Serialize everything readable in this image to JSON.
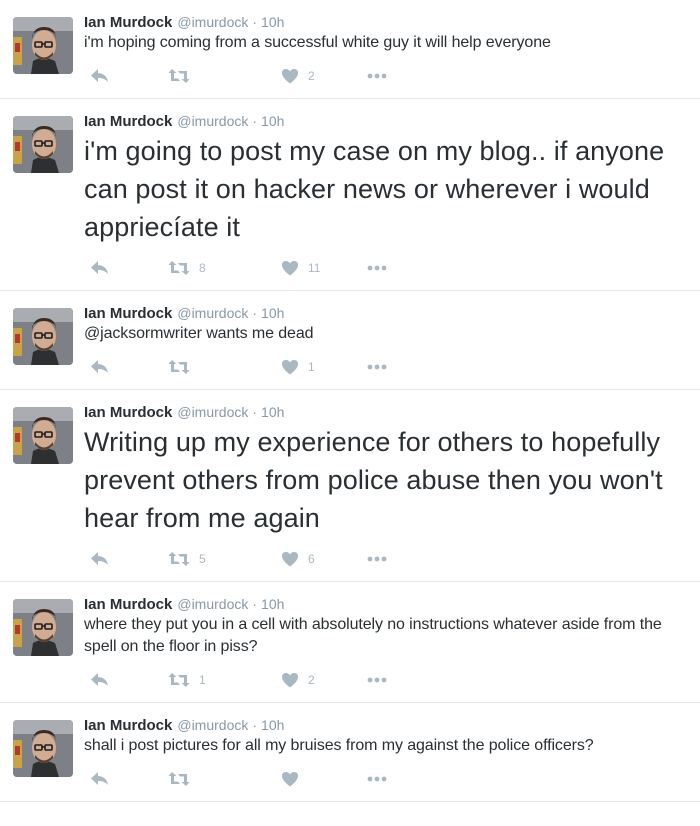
{
  "tweets": [
    {
      "name": "Ian Murdock",
      "handle": "@imurdock",
      "sep": "·",
      "time": "10h",
      "text": "i'm hoping coming from a successful white guy it will help everyone",
      "size": "small",
      "retweets": "",
      "likes": "2"
    },
    {
      "name": "Ian Murdock",
      "handle": "@imurdock",
      "sep": "·",
      "time": "10h",
      "text": "i'm going to post my case on my blog.. if anyone can post it on hacker news or wherever i would appriecíate it",
      "size": "large",
      "retweets": "8",
      "likes": "11"
    },
    {
      "name": "Ian Murdock",
      "handle": "@imurdock",
      "sep": "·",
      "time": "10h",
      "text": "@jacksormwriter wants me dead",
      "size": "small",
      "retweets": "",
      "likes": "1"
    },
    {
      "name": "Ian Murdock",
      "handle": "@imurdock",
      "sep": "·",
      "time": "10h",
      "text": "Writing up my experience for others to hopefully prevent others from police abuse then you won't hear from me again",
      "size": "large",
      "retweets": "5",
      "likes": "6"
    },
    {
      "name": "Ian Murdock",
      "handle": "@imurdock",
      "sep": "·",
      "time": "10h",
      "text": "where they put you in a cell with absolutely no instructions whatever aside from the spell on the floor in piss?",
      "size": "small",
      "retweets": "1",
      "likes": "2"
    },
    {
      "name": "Ian Murdock",
      "handle": "@imurdock",
      "sep": "·",
      "time": "10h",
      "text": "shall i post pictures for all my bruises from my against the police officers?",
      "size": "small",
      "retweets": "",
      "likes": ""
    }
  ],
  "icons": {
    "reply": "reply-icon",
    "retweet": "retweet-icon",
    "like": "heart-icon",
    "more": "more-icon"
  },
  "colors": {
    "name": "#292f33",
    "meta": "#8899a6",
    "action": "#aab8c2",
    "divider": "#e1e8ed"
  }
}
